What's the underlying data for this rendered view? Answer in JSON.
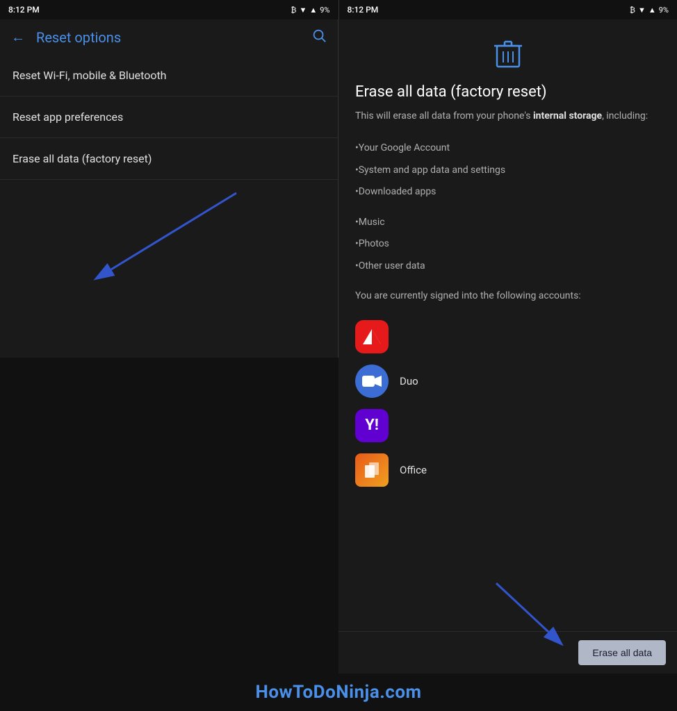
{
  "left_screen": {
    "status_time": "8:12 PM",
    "title": "Reset options",
    "menu_items": [
      {
        "id": "wifi",
        "label": "Reset Wi-Fi, mobile & Bluetooth"
      },
      {
        "id": "app_prefs",
        "label": "Reset app preferences"
      },
      {
        "id": "factory",
        "label": "Erase all data (factory reset)"
      }
    ]
  },
  "right_screen": {
    "status_time": "8:12 PM",
    "title": "Erase all data (factory reset)",
    "description_1": "This will erase all data from your phone's ",
    "description_bold": "internal storage",
    "description_2": ", including:",
    "erase_items": [
      "•Your Google Account",
      "•System and app data and settings",
      "•Downloaded apps",
      "•Music",
      "•Photos",
      "•Other user data"
    ],
    "accounts_text": "You are currently signed into the following accounts:",
    "accounts": [
      {
        "id": "adobe",
        "label": "",
        "type": "adobe"
      },
      {
        "id": "duo",
        "label": "Duo",
        "type": "duo"
      },
      {
        "id": "yahoo",
        "label": "",
        "type": "yahoo"
      },
      {
        "id": "office",
        "label": "Office",
        "type": "office"
      }
    ],
    "erase_button_label": "Erase all data"
  },
  "watermark": "HowToDoNinja.com",
  "icons": {
    "back": "←",
    "search": "🔍",
    "trash": "🗑",
    "bluetooth": "B",
    "wifi": "W",
    "signal": "📶",
    "battery": "9%"
  }
}
